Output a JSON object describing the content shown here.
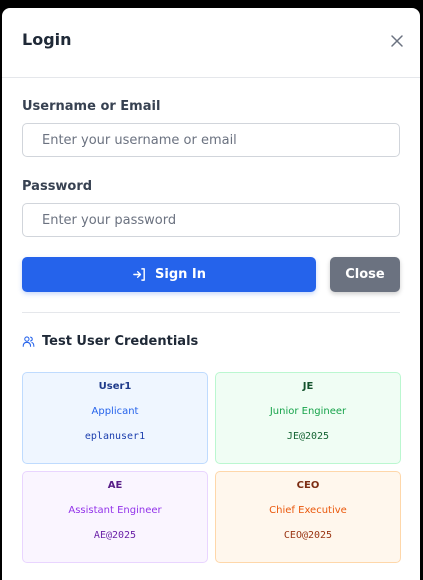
{
  "modal": {
    "title": "Login",
    "close_icon": "close-icon"
  },
  "form": {
    "username_label": "Username or Email",
    "username_placeholder": "Enter your username or email",
    "username_value": "",
    "password_label": "Password",
    "password_placeholder": "Enter your password",
    "password_value": "",
    "signin_label": "Sign In",
    "signin_icon": "sign-in-icon",
    "close_label": "Close"
  },
  "credentials": {
    "icon": "users-icon",
    "title": "Test User Credentials",
    "users": [
      {
        "name": "User1",
        "role": "Applicant",
        "password": "eplanuser1",
        "color": "#2563eb"
      },
      {
        "name": "JE",
        "role": "Junior Engineer",
        "password": "JE@2025",
        "color": "#16a34a"
      },
      {
        "name": "AE",
        "role": "Assistant Engineer",
        "password": "AE@2025",
        "color": "#9333ea"
      },
      {
        "name": "CEO",
        "role": "Chief Executive",
        "password": "CEO@2025",
        "color": "#ea580c"
      }
    ]
  },
  "colors": {
    "primary": "#2563eb",
    "secondary": "#6b7280",
    "overlay": "#000000"
  }
}
